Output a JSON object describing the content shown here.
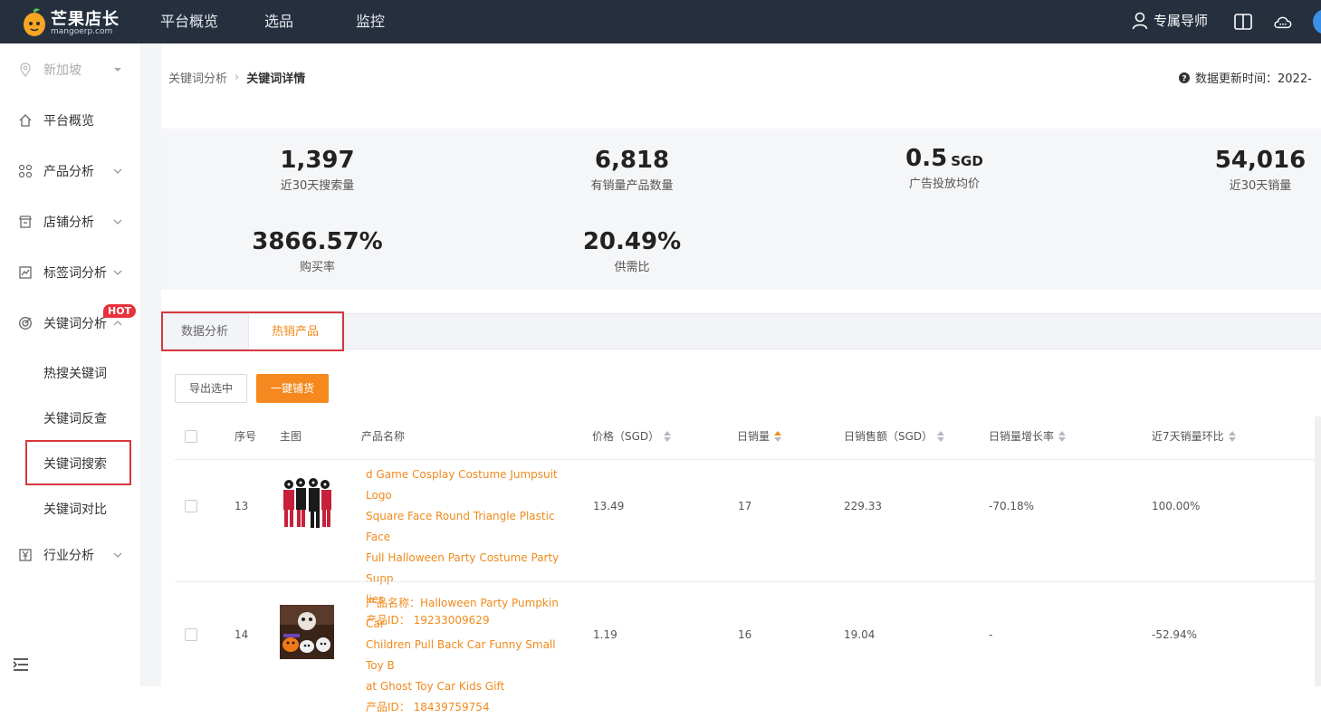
{
  "topbar": {
    "brand": "芒果店长",
    "domain": "mangoerp.com",
    "nav": [
      "平台概览",
      "选品",
      "监控"
    ],
    "tutor": "专属导师"
  },
  "sidebar": {
    "region": "新加坡",
    "items": [
      {
        "label": "平台概览",
        "icon": "home-icon"
      },
      {
        "label": "产品分析",
        "icon": "grid-icon"
      },
      {
        "label": "店铺分析",
        "icon": "store-icon"
      },
      {
        "label": "标签词分析",
        "icon": "chart-icon"
      },
      {
        "label": "关键词分析",
        "icon": "target-icon",
        "badge": "HOT"
      },
      {
        "label": "行业分析",
        "icon": "yen-icon"
      }
    ],
    "sub_items": [
      "热搜关键词",
      "关键词反查",
      "关键词搜索",
      "关键词对比"
    ]
  },
  "breadcrumb": {
    "parent": "关键词分析",
    "current": "关键词详情"
  },
  "update_time": "数据更新时间：2022-",
  "stats": [
    {
      "value": "1,397",
      "unit": "",
      "label": "近30天搜索量"
    },
    {
      "value": "6,818",
      "unit": "",
      "label": "有销量产品数量"
    },
    {
      "value": "0.5",
      "unit": "SGD",
      "label": "广告投放均价"
    },
    {
      "value": "54,016",
      "unit": "",
      "label": "近30天销量"
    },
    {
      "value": "3866.57%",
      "unit": "",
      "label": "购买率"
    },
    {
      "value": "20.49%",
      "unit": "",
      "label": "供需比"
    }
  ],
  "tabs": {
    "data": "数据分析",
    "hot": "热销产品"
  },
  "buttons": {
    "export": "导出选中",
    "one_key": "一键铺货"
  },
  "table": {
    "headers": {
      "index": "序号",
      "image": "主图",
      "name": "产品名称",
      "price": "价格（SGD）",
      "daily_sales": "日销量",
      "daily_amount": "日销售额（SGD）",
      "growth": "日销量增长率",
      "week_ratio": "近7天销量环比"
    },
    "rows": [
      {
        "index": "13",
        "name_lines": [
          "d Game Cosplay Costume Jumpsuit Logo",
          "Square Face Round Triangle Plastic Face",
          "Full Halloween Party Costume Party Supp",
          "lies"
        ],
        "product_id": "产品ID：  19233009629",
        "price": "13.49",
        "daily_sales": "17",
        "daily_amount": "229.33",
        "growth": "-70.18%",
        "week_ratio": "100.00%"
      },
      {
        "index": "14",
        "name_lines": [
          "产品名称：Halloween Party Pumpkin Car",
          "Children Pull Back Car Funny Small Toy B",
          "at Ghost Toy Car Kids Gift"
        ],
        "product_id": "产品ID：  18439759754",
        "price": "1.19",
        "daily_sales": "16",
        "daily_amount": "19.04",
        "growth": "-",
        "week_ratio": "-52.94%"
      }
    ]
  },
  "colors": {
    "accent": "#f08a1c",
    "topbar": "#252f3e",
    "highlight": "#d9363e",
    "hot": "#e8313b"
  }
}
